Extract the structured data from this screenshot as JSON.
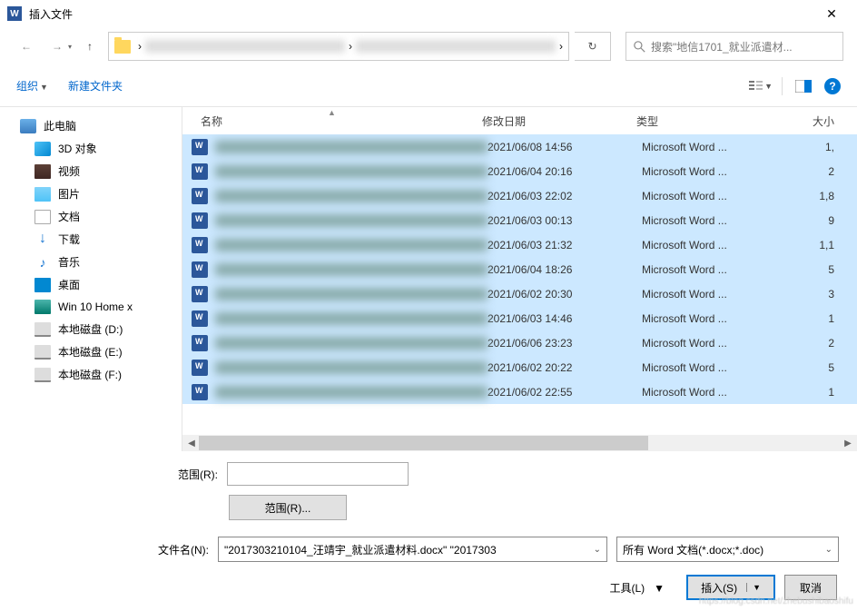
{
  "title_bar": {
    "title": "插入文件",
    "close": "✕",
    "app_letter": "W"
  },
  "nav": {
    "back": "←",
    "forward": "→",
    "up": "↑",
    "path_sep": "›",
    "refresh": "↻",
    "search_placeholder": "搜索\"地信1701_就业派遣材..."
  },
  "toolbar": {
    "organize": "组织",
    "new_folder": "新建文件夹",
    "help": "?"
  },
  "sidebar": {
    "items": [
      {
        "label": "此电脑",
        "icon": "ico-pc",
        "sub": false
      },
      {
        "label": "3D 对象",
        "icon": "ico-3d",
        "sub": true
      },
      {
        "label": "视频",
        "icon": "ico-video",
        "sub": true
      },
      {
        "label": "图片",
        "icon": "ico-img",
        "sub": true
      },
      {
        "label": "文档",
        "icon": "ico-doc",
        "sub": true
      },
      {
        "label": "下载",
        "icon": "ico-dl",
        "sub": true,
        "glyph": "↓"
      },
      {
        "label": "音乐",
        "icon": "ico-music",
        "sub": true,
        "glyph": "♪"
      },
      {
        "label": "桌面",
        "icon": "ico-desk",
        "sub": true
      },
      {
        "label": "Win 10 Home x",
        "icon": "ico-win",
        "sub": true
      },
      {
        "label": "本地磁盘 (D:)",
        "icon": "ico-disk",
        "sub": true
      },
      {
        "label": "本地磁盘 (E:)",
        "icon": "ico-disk",
        "sub": true
      },
      {
        "label": "本地磁盘 (F:)",
        "icon": "ico-disk",
        "sub": true
      }
    ]
  },
  "columns": {
    "name": "名称",
    "date": "修改日期",
    "type": "类型",
    "size": "大小"
  },
  "files": [
    {
      "date": "2021/06/08 14:56",
      "type": "Microsoft Word ...",
      "size": "1,"
    },
    {
      "date": "2021/06/04 20:16",
      "type": "Microsoft Word ...",
      "size": "2"
    },
    {
      "date": "2021/06/03 22:02",
      "type": "Microsoft Word ...",
      "size": "1,8"
    },
    {
      "date": "2021/06/03 00:13",
      "type": "Microsoft Word ...",
      "size": "9"
    },
    {
      "date": "2021/06/03 21:32",
      "type": "Microsoft Word ...",
      "size": "1,1"
    },
    {
      "date": "2021/06/04 18:26",
      "type": "Microsoft Word ...",
      "size": "5"
    },
    {
      "date": "2021/06/02 20:30",
      "type": "Microsoft Word ...",
      "size": "3"
    },
    {
      "date": "2021/06/03 14:46",
      "type": "Microsoft Word ...",
      "size": "1"
    },
    {
      "date": "2021/06/06 23:23",
      "type": "Microsoft Word ...",
      "size": "2"
    },
    {
      "date": "2021/06/02 20:22",
      "type": "Microsoft Word ...",
      "size": "5"
    },
    {
      "date": "2021/06/02 22:55",
      "type": "Microsoft Word ...",
      "size": "1"
    }
  ],
  "range": {
    "label": "范围(R):",
    "button": "范围(R)..."
  },
  "filename": {
    "label": "文件名(N):",
    "value": "\"2017303210104_汪靖宇_就业派遣材料.docx\" \"2017303",
    "filter": "所有 Word 文档(*.docx;*.doc)"
  },
  "actions": {
    "tools": "工具(L)",
    "insert": "插入(S)",
    "cancel": "取消"
  },
  "watermark": "https://blog.csdn.net/zhebushibaoshifu"
}
